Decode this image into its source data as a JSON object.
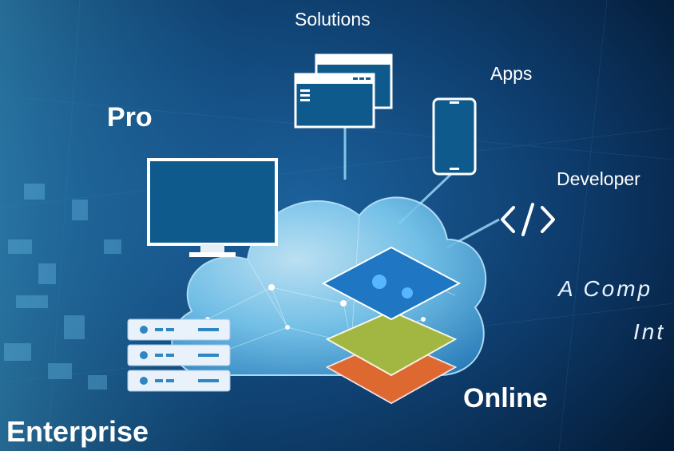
{
  "labels": {
    "solutions": "Solutions",
    "apps": "Apps",
    "pro": "Pro",
    "developer": "Developer",
    "online": "Online",
    "enterprise": "Enterprise"
  },
  "tagline": {
    "line1": "A Comp",
    "line2": "Int"
  },
  "icons": [
    "browser-windows-icon",
    "smartphone-icon",
    "desktop-monitor-icon",
    "code-brackets-icon",
    "server-stack-icon",
    "map-layers-icon",
    "cloud-icon"
  ],
  "colors": {
    "background": "#06223f",
    "cloud": "#7fd0f5",
    "icon_blue": "#0e5a8c",
    "label_white": "#ffffff"
  }
}
